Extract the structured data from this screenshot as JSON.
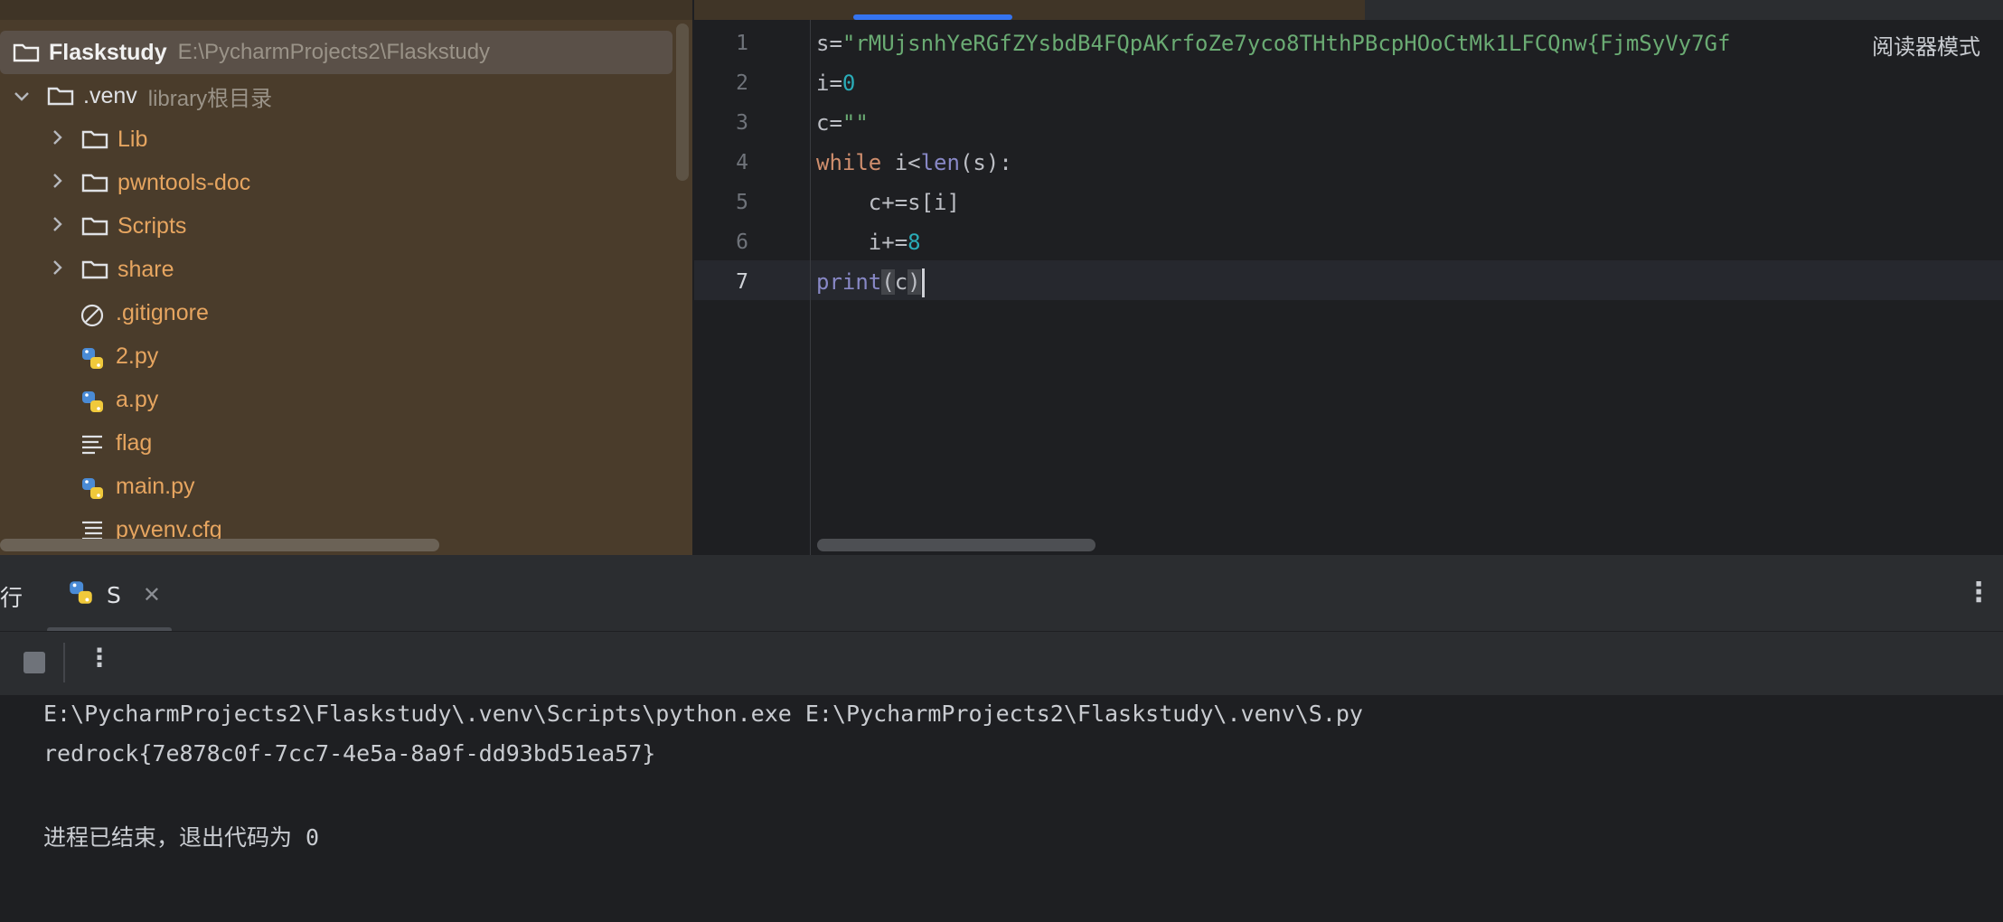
{
  "project": {
    "root": {
      "name": "Flaskstudy",
      "path": "E:\\PycharmProjects2\\Flaskstudy"
    },
    "venv": {
      "name": ".venv",
      "hint": "library根目录"
    },
    "folders": [
      "Lib",
      "pwntools-doc",
      "Scripts",
      "share"
    ],
    "files": [
      ".gitignore",
      "2.py",
      "a.py",
      "flag",
      "main.py",
      "pyvenv.cfg"
    ]
  },
  "editor": {
    "line_numbers": [
      "1",
      "2",
      "3",
      "4",
      "5",
      "6",
      "7"
    ],
    "lines": [
      {
        "a": "s=",
        "str": "\"rMUjsnhYeRGfZYsbdB4FQpAKrfoZe7yco8THthPBcpHOoCtMk1LFCQnw{FjmSyVy7Gf"
      },
      {
        "a": "i=",
        "num": "0"
      },
      {
        "a": "c=",
        "str": "\"\""
      },
      {
        "kw": "while",
        "a": " i<",
        "fn": "len",
        "b": "(s):"
      },
      {
        "a": "    c+=s[i]"
      },
      {
        "a": "    i+=",
        "num": "8"
      },
      {
        "fn": "print",
        "p1": "(",
        "a": "c",
        "p2": ")"
      }
    ],
    "reader_mode": "阅读器模式"
  },
  "run": {
    "title": "行",
    "tab_label": "S",
    "output": [
      "E:\\PycharmProjects2\\Flaskstudy\\.venv\\Scripts\\python.exe E:\\PycharmProjects2\\Flaskstudy\\.venv\\S.py",
      "redrock{7e878c0f-7cc7-4e5a-8a9f-dd93bd51ea57}",
      "",
      "进程已结束，退出代码为 0"
    ]
  }
}
